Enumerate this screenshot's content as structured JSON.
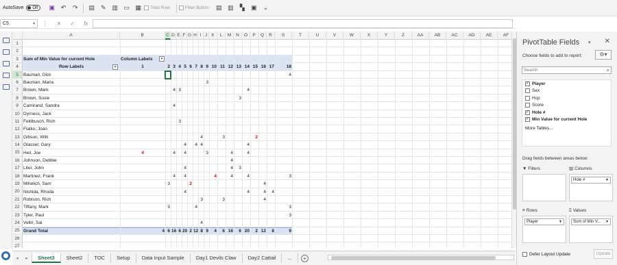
{
  "qat": {
    "autosave_label": "AutoSave",
    "autosave_state": "Off",
    "total_row_label": "Total Row",
    "filter_button_label": "Filter Button"
  },
  "formula_bar": {
    "name_box": "C5",
    "fx": "fx"
  },
  "columns": [
    "A",
    "B",
    "C",
    "D",
    "E",
    "F",
    "G",
    "H",
    "I",
    "J",
    "K",
    "L",
    "M",
    "N",
    "O",
    "P",
    "Q",
    "R",
    "S",
    "T",
    "U",
    "V",
    "W",
    "X",
    "Y",
    "Z",
    "AA",
    "AB",
    "AC",
    "AD",
    "AE",
    "AF"
  ],
  "selected_column": "C",
  "rows": [
    "1",
    "2",
    "3",
    "4",
    "5",
    "6",
    "7",
    "8",
    "9",
    "10",
    "11",
    "12",
    "13",
    "14",
    "15",
    "16",
    "17",
    "18",
    "19",
    "20",
    "21",
    "22",
    "23",
    "24",
    "25",
    "26",
    "27"
  ],
  "selected_row": "5",
  "pivot": {
    "values_header": "Sum of Min Value for current Hole",
    "column_labels": "Column Labels",
    "row_labels": "Row Labels",
    "hole_headers": [
      "1",
      "2",
      "3",
      "4",
      "5",
      "6",
      "7",
      "8",
      "9",
      "10",
      "11",
      "12",
      "13",
      "14",
      "15",
      "16",
      "17",
      "18"
    ],
    "rows": [
      {
        "name": "Bauman, Dick",
        "cells": {
          "18": "4"
        }
      },
      {
        "name": "Bauman, Maria",
        "cells": {
          "9": "3"
        }
      },
      {
        "name": "Brown, Mark",
        "cells": {
          "3": "4",
          "4": "3",
          "14": "4"
        }
      },
      {
        "name": "Brown, Susie",
        "cells": {
          "13": "3"
        }
      },
      {
        "name": "Camirand, Sandra",
        "cells": {
          "3": "4"
        }
      },
      {
        "name": "Dyrness, Jack",
        "cells": {}
      },
      {
        "name": "Feldbusch, Rich",
        "cells": {
          "4": "3"
        }
      },
      {
        "name": "Fialko, Joan",
        "cells": {}
      },
      {
        "name": "Gibson, Willi",
        "cells": {
          "8": "4",
          "11": "3",
          "15": "2"
        }
      },
      {
        "name": "Glasser, Gary",
        "cells": {
          "5": "4",
          "7": "4",
          "8": "4",
          "14": "4"
        }
      },
      {
        "name": "Heil, Joe",
        "cells": {
          "1": "4",
          "3": "4",
          "5": "4",
          "9": "3",
          "12": "4",
          "14": "4"
        }
      },
      {
        "name": "Johnson, Debbie",
        "cells": {
          "12": "4"
        }
      },
      {
        "name": "Liter, John",
        "cells": {
          "5": "4",
          "12": "4",
          "13": "3"
        }
      },
      {
        "name": "Martinez, Frank",
        "cells": {
          "3": "4",
          "5": "4",
          "10": "4",
          "12": "4",
          "14": "4",
          "18": "3"
        }
      },
      {
        "name": "Mihelich, Sam",
        "cells": {
          "2": "3",
          "6": "2",
          "16": "4"
        }
      },
      {
        "name": "Nishida, Rhoda",
        "cells": {
          "5": "4",
          "14": "4",
          "16": "4",
          "17": "4"
        }
      },
      {
        "name": "Robison, Rich",
        "cells": {
          "8": "3",
          "11": "3",
          "16": "4"
        }
      },
      {
        "name": "Tiffany, Mark",
        "cells": {
          "2": "3",
          "7": "4",
          "18": "3"
        }
      },
      {
        "name": "Tyler, Paul",
        "cells": {
          "18": "3"
        }
      },
      {
        "name": "Veltri, Sal",
        "cells": {
          "8": "4"
        }
      }
    ],
    "red_cells": [
      [
        "Gibson, Willi",
        "15"
      ],
      [
        "Heil, Joe",
        "1"
      ],
      [
        "Martinez, Frank",
        "10"
      ],
      [
        "Mihelich, Sam",
        "6"
      ]
    ],
    "grand_total_label": "Grand Total",
    "grand_totals": [
      "4",
      "6",
      "16",
      "6",
      "20",
      "2",
      "12",
      "8",
      "9",
      "4",
      "6",
      "16",
      "6",
      "20",
      "2",
      "12",
      "8",
      "9"
    ]
  },
  "sheet_tabs": [
    "Sheet3",
    "Sheet2",
    "TOC",
    "Setup",
    "Data Input Sample",
    "Day1 Devils Claw",
    "Day2 Cattail",
    "..."
  ],
  "active_tab": "Sheet3",
  "panel": {
    "title": "PivotTable Fields",
    "choose_label": "Choose fields to add to report:",
    "search_placeholder": "Search",
    "fields": [
      {
        "label": "Player",
        "checked": true
      },
      {
        "label": "Sex",
        "checked": false
      },
      {
        "label": "Hcp",
        "checked": false
      },
      {
        "label": "Score",
        "checked": false
      },
      {
        "label": "Hole #",
        "checked": true
      },
      {
        "label": "Min Value for current Hole",
        "checked": true
      }
    ],
    "more_tables": "More Tables...",
    "drag_label": "Drag fields between areas below:",
    "filters_label": "Filters",
    "columns_label": "Columns",
    "columns_item": "Hole #",
    "rows_label": "Rows",
    "rows_item": "Player",
    "values_label": "Values",
    "values_item": "Sum of Min V...",
    "defer_label": "Defer Layout Update",
    "update_label": "Update"
  }
}
